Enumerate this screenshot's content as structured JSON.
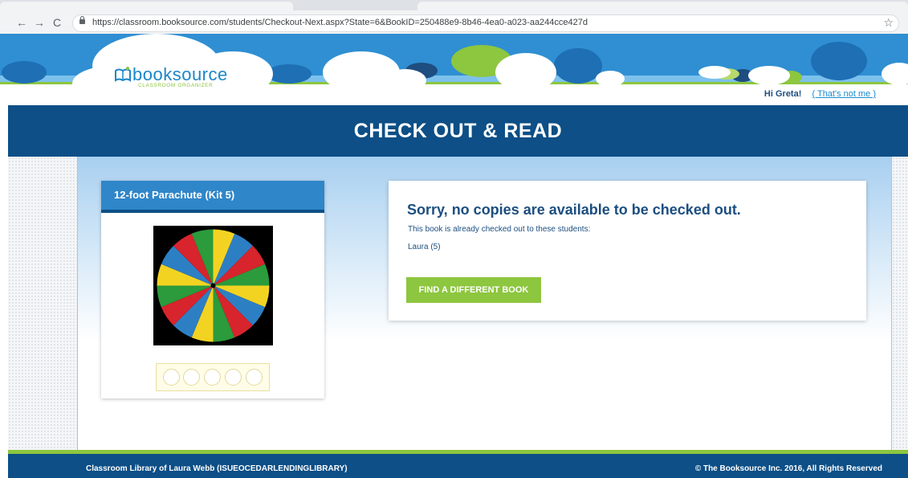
{
  "browser": {
    "url": "https://classroom.booksource.com/students/Checkout-Next.aspx?State=6&BookID=250488e9-8b46-4ea0-a023-aa244cce427d",
    "back_icon": "←",
    "forward_icon": "→",
    "reload_icon": "C",
    "star_icon": "☆"
  },
  "header": {
    "logo_text": "booksource",
    "logo_subtitle": "CLASSROOM ORGANIZER",
    "greeting": "Hi Greta!",
    "not_me_link": "( That's not me )"
  },
  "page_title": "CHECK OUT & READ",
  "item": {
    "title": "12-foot Parachute (Kit 5)",
    "rating_circles": 5,
    "parachute_colors": [
      "#f3d321",
      "#2d7fc4",
      "#d8242c",
      "#2b9b3b"
    ]
  },
  "message": {
    "heading": "Sorry, no copies are available to be checked out.",
    "subtext": "This book is already checked out to these students:",
    "students": [
      "Laura (5)"
    ],
    "button_label": "FIND A DIFFERENT BOOK"
  },
  "footer": {
    "left": "Classroom Library of Laura Webb (ISUEOCEDARLENDINGLIBRARY)",
    "right": "© The Booksource Inc. 2016, All Rights Reserved"
  },
  "colors": {
    "brand_dark": "#0d4f86",
    "brand_blue": "#2f86c9",
    "accent_green": "#8dc63f"
  }
}
